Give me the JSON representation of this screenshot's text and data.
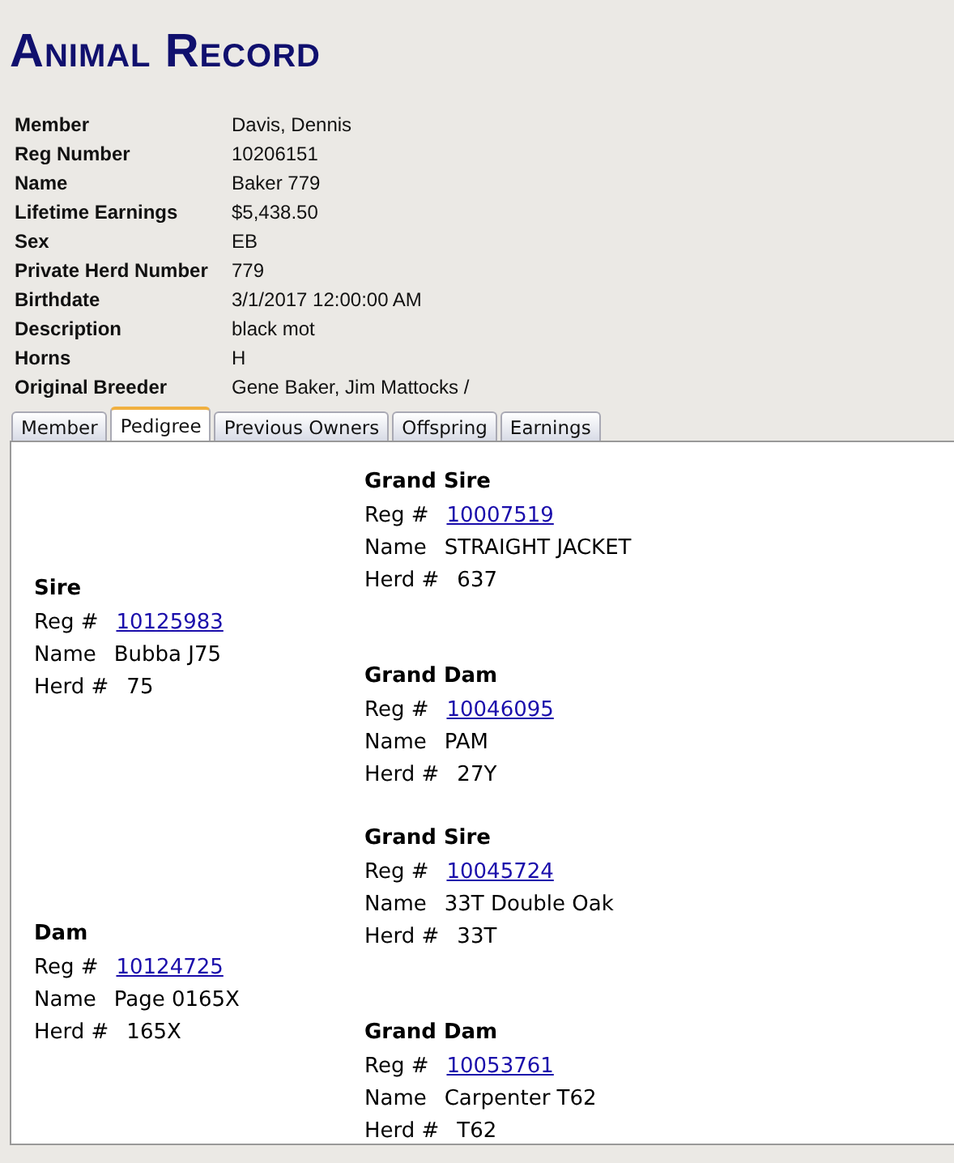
{
  "title": "Animal Record",
  "details": [
    {
      "label": "Member",
      "value": "Davis, Dennis"
    },
    {
      "label": "Reg Number",
      "value": "10206151"
    },
    {
      "label": "Name",
      "value": "Baker 779"
    },
    {
      "label": "Lifetime Earnings",
      "value": "$5,438.50"
    },
    {
      "label": "Sex",
      "value": "EB"
    },
    {
      "label": "Private Herd Number",
      "value": "779"
    },
    {
      "label": "Birthdate",
      "value": "3/1/2017 12:00:00 AM"
    },
    {
      "label": "Description",
      "value": "black mot"
    },
    {
      "label": "Horns",
      "value": "H"
    },
    {
      "label": "Original Breeder",
      "value": "Gene Baker, Jim Mattocks /"
    }
  ],
  "tabs": [
    {
      "label": "Member",
      "selected": false
    },
    {
      "label": "Pedigree",
      "selected": true
    },
    {
      "label": "Previous Owners",
      "selected": false
    },
    {
      "label": "Offspring",
      "selected": false
    },
    {
      "label": "Earnings",
      "selected": false
    }
  ],
  "pedigree": [
    {
      "parent": {
        "heading": "Sire",
        "reg_label": "Reg #",
        "reg": "10125983",
        "name_label": "Name",
        "name": "Bubba J75",
        "herd_label": "Herd #",
        "herd": "75"
      },
      "grandparents": [
        {
          "heading": "Grand Sire",
          "reg_label": "Reg #",
          "reg": "10007519",
          "name_label": "Name",
          "name": "STRAIGHT JACKET",
          "herd_label": "Herd #",
          "herd": "637"
        },
        {
          "heading": "Grand Dam",
          "reg_label": "Reg #",
          "reg": "10046095",
          "name_label": "Name",
          "name": "PAM",
          "herd_label": "Herd #",
          "herd": "27Y"
        }
      ]
    },
    {
      "parent": {
        "heading": "Dam",
        "reg_label": "Reg #",
        "reg": "10124725",
        "name_label": "Name",
        "name": "Page 0165X",
        "herd_label": "Herd #",
        "herd": "165X"
      },
      "grandparents": [
        {
          "heading": "Grand Sire",
          "reg_label": "Reg #",
          "reg": "10045724",
          "name_label": "Name",
          "name": "33T Double Oak",
          "herd_label": "Herd #",
          "herd": "33T"
        },
        {
          "heading": "Grand Dam",
          "reg_label": "Reg #",
          "reg": "10053761",
          "name_label": "Name",
          "name": "Carpenter T62",
          "herd_label": "Herd #",
          "herd": "T62"
        }
      ]
    }
  ]
}
